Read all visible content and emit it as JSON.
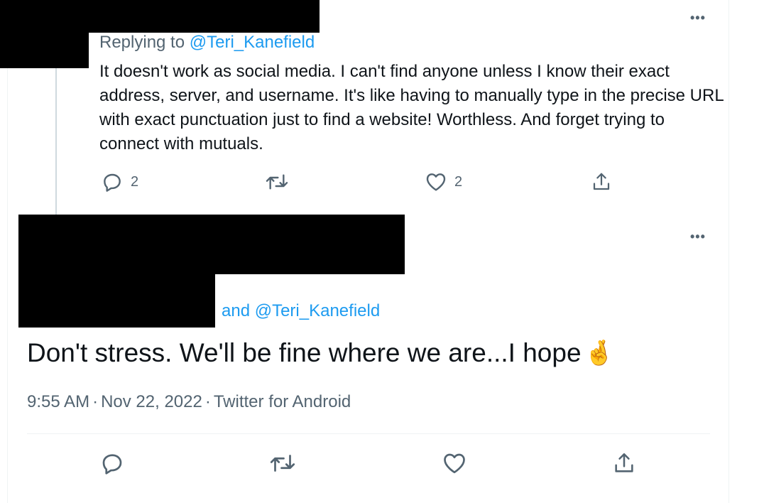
{
  "reply_tweet": {
    "replying_prefix": "Replying to",
    "replying_to": "@Teri_Kanefield",
    "text": "It doesn't work as social media. I can't find anyone unless I know their exact address, server, and username. It's like having to manually type in the precise URL with exact punctuation just to find a website! Worthless. And forget trying to connect with mutuals.",
    "reply_count": "2",
    "retweet_count": "",
    "like_count": "2"
  },
  "main_tweet": {
    "replying_suffix": "and @Teri_Kanefield",
    "text": "Don't stress. We'll be fine where we are...I hope",
    "emoji": "🤞",
    "time": "9:55 AM",
    "date": "Nov 22, 2022",
    "source": "Twitter for Android",
    "separator": "·"
  },
  "icons": {
    "more": "more-icon",
    "reply": "reply-icon",
    "retweet": "retweet-icon",
    "like": "heart-icon",
    "share": "share-icon"
  },
  "colors": {
    "accent": "#1d9bf0",
    "text": "#0f1419",
    "muted": "#536471",
    "border": "#eff3f4",
    "redaction": "#000000"
  }
}
